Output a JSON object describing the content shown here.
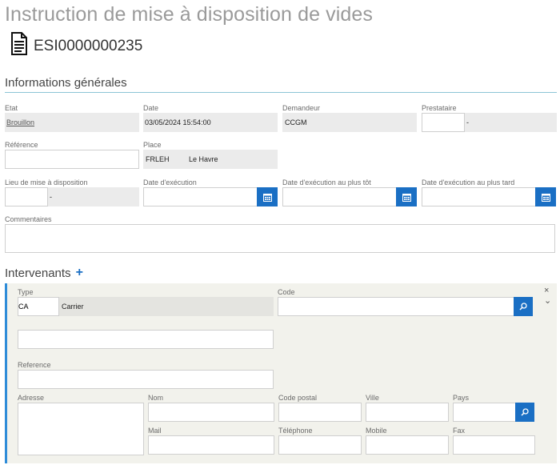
{
  "header": {
    "title": "Instruction de mise à disposition de vides",
    "doc_number": "ESI0000000235"
  },
  "general": {
    "section_title": "Informations générales",
    "etat_label": "Etat",
    "etat_value": "Brouillon",
    "date_label": "Date",
    "date_value": "03/05/2024 15:54:00",
    "demandeur_label": "Demandeur",
    "demandeur_value": "CCGM",
    "prestataire_label": "Prestataire",
    "prestataire_code": "",
    "prestataire_name": "-",
    "reference_label": "Référence",
    "reference_value": "",
    "place_label": "Place",
    "place_code": "FRLEH",
    "place_name": "Le Havre",
    "lieu_label": "Lieu de mise à disposition",
    "lieu_code": "",
    "lieu_name": "-",
    "date_exec_label": "Date d'exécution",
    "date_exec_value": "",
    "date_tot_label": "Date d'exécution au plus tôt",
    "date_tot_value": "",
    "date_tard_label": "Date d'exécution au plus tard",
    "date_tard_value": "",
    "commentaires_label": "Commentaires",
    "commentaires_value": ""
  },
  "intervenants": {
    "section_title": "Intervenants",
    "add_symbol": "+",
    "close_symbol": "×",
    "collapse_symbol": "⌄",
    "type_label": "Type",
    "type_code": "CA",
    "type_name": "Carrier",
    "code_label": "Code",
    "code_value": "",
    "name_value": "",
    "reference_label": "Reference",
    "reference_value": "",
    "adresse_label": "Adresse",
    "nom_label": "Nom",
    "code_postal_label": "Code postal",
    "ville_label": "Ville",
    "pays_label": "Pays",
    "mail_label": "Mail",
    "telephone_label": "Téléphone",
    "mobile_label": "Mobile",
    "fax_label": "Fax"
  },
  "icons": {
    "document": "document-icon",
    "calendar": "calendar-icon",
    "search": "search-icon",
    "close": "close-icon",
    "collapse": "chevron-down-icon"
  },
  "colors": {
    "accent": "#1a6fc4",
    "panel_border": "#2e8cd8",
    "section_rule": "#8cc4d6"
  }
}
